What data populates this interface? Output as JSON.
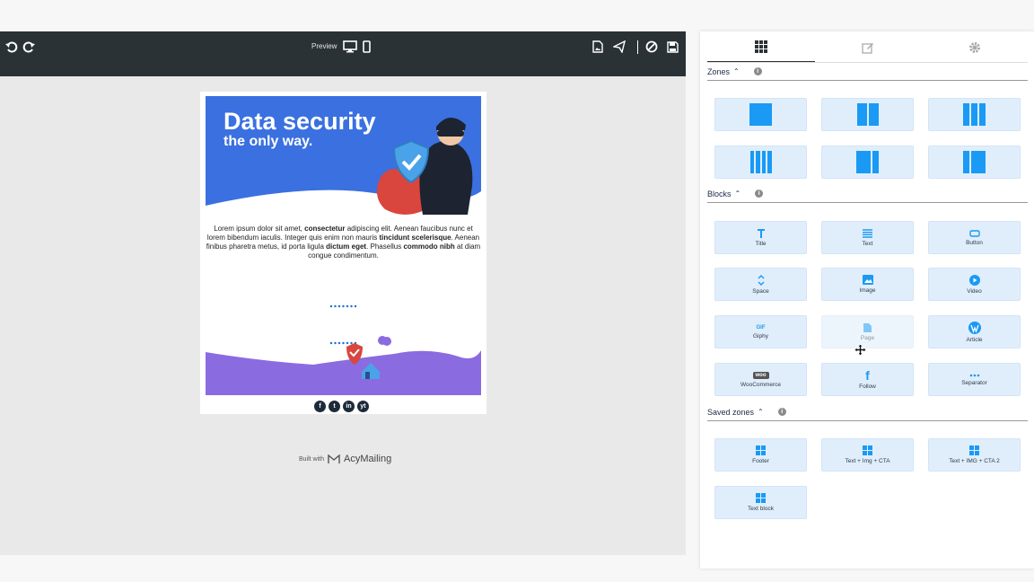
{
  "toolbar": {
    "preview_label": "Preview",
    "icons": [
      "undo-icon",
      "redo-icon",
      "desktop-icon",
      "mobile-icon",
      "image-icon",
      "send-icon",
      "cancel-icon",
      "save-icon"
    ]
  },
  "email": {
    "hero_title": "Data security",
    "hero_subtitle": "the only way.",
    "body_parts": [
      {
        "t": "Lorem ipsum dolor sit amet, ",
        "b": false
      },
      {
        "t": "consectetur",
        "b": true
      },
      {
        "t": " adipiscing elit. Aenean faucibus nunc et lorem bibendum iaculis. Integer quis enim non mauris ",
        "b": false
      },
      {
        "t": "tincidunt scelerisque",
        "b": true
      },
      {
        "t": ". Aenean finibus pharetra metus, id porta ligula ",
        "b": false
      },
      {
        "t": "dictum eget",
        "b": true
      },
      {
        "t": ". Phasellus ",
        "b": false
      },
      {
        "t": "commodo nibh",
        "b": true
      },
      {
        "t": " at diam congue condimentum.",
        "b": false
      }
    ],
    "social_icons": [
      "f",
      "t",
      "in",
      "yt"
    ]
  },
  "built_with": {
    "prefix": "Built with",
    "brand": "AcyMailing"
  },
  "panel": {
    "tabs": [
      "grid-tab",
      "edit-tab",
      "settings-tab"
    ],
    "zones_title": "Zones",
    "blocks_title": "Blocks",
    "saved_title": "Saved zones",
    "blocks": [
      "Title",
      "Text",
      "Button",
      "Space",
      "Image",
      "Video",
      "Giphy",
      "Page",
      "Article",
      "WooCommerce",
      "Follow",
      "Separator"
    ],
    "saved_zones": [
      "Footer",
      "Text + Img + CTA",
      "Text + IMG + CTA 2",
      "Text block"
    ]
  },
  "colors": {
    "accent": "#1a9af5",
    "toolbar": "#2b3236",
    "hero": "#3a70e0",
    "wave": "#8b6be0"
  }
}
